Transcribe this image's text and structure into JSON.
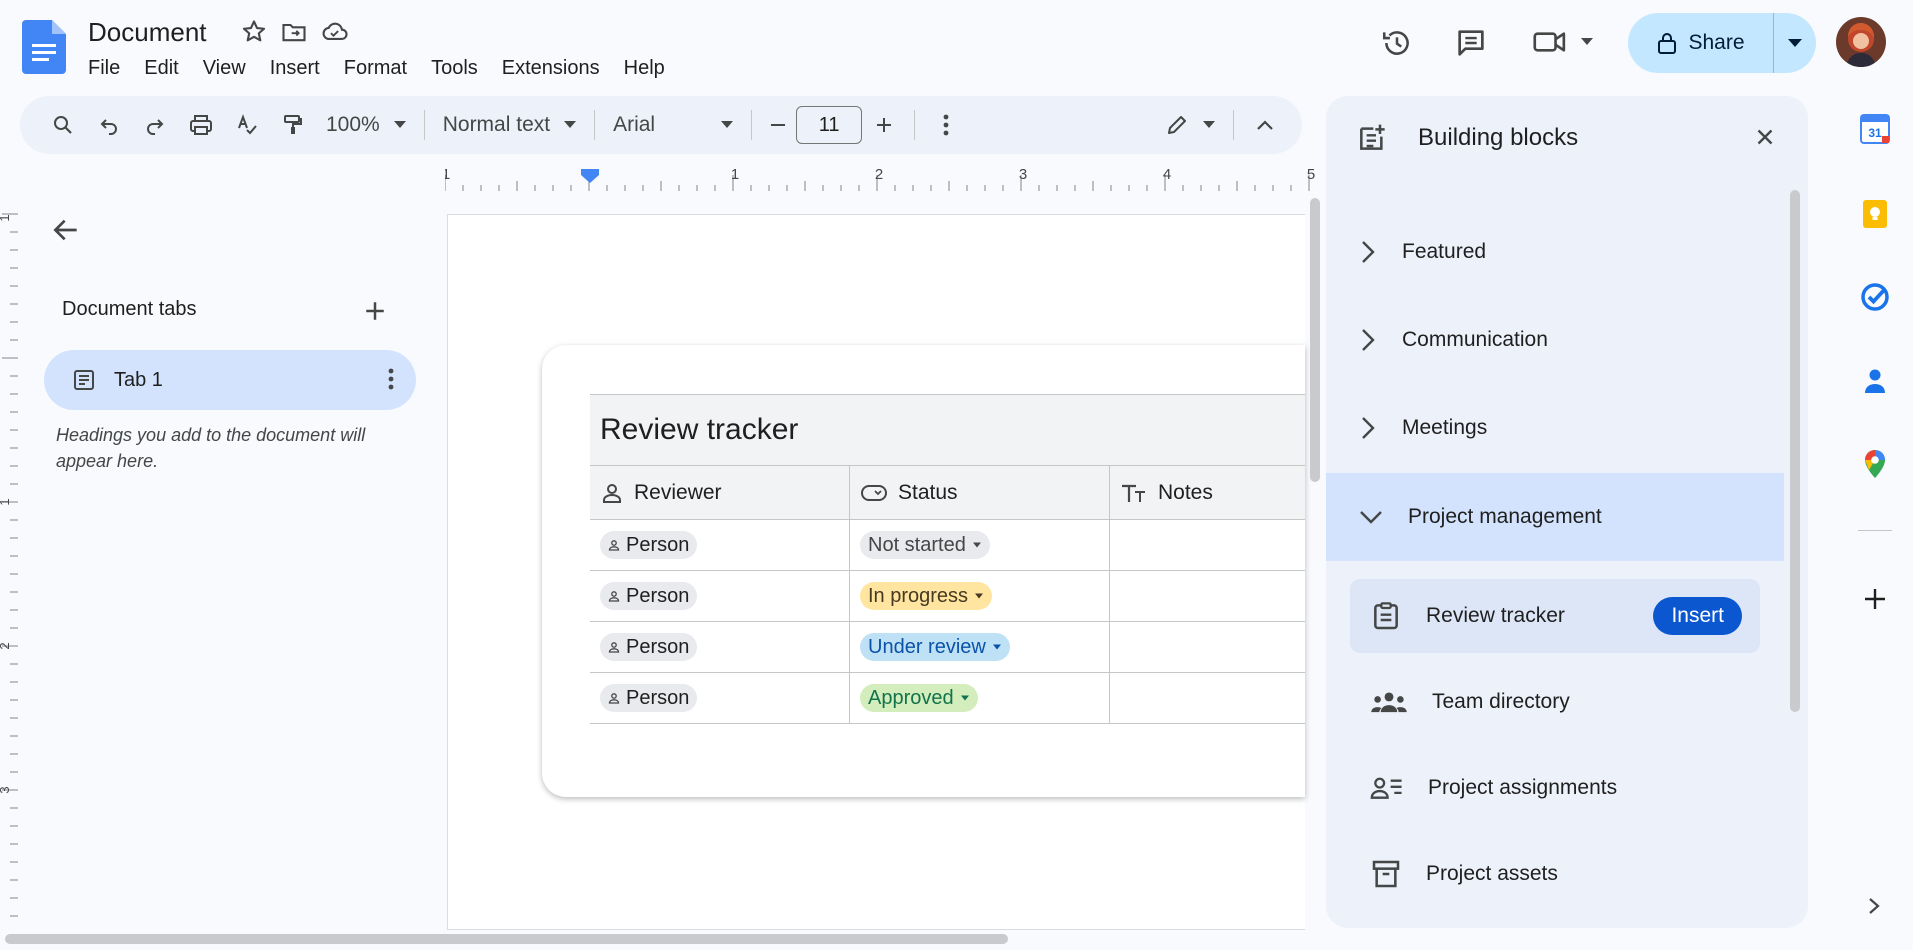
{
  "header": {
    "title": "Document",
    "menu": [
      "File",
      "Edit",
      "View",
      "Insert",
      "Format",
      "Tools",
      "Extensions",
      "Help"
    ],
    "share_label": "Share"
  },
  "toolbar": {
    "zoom": "100%",
    "style": "Normal text",
    "font": "Arial",
    "font_size": "11"
  },
  "ruler": {
    "h_ticks": [
      "1",
      "1",
      "2",
      "3",
      "4",
      "5"
    ],
    "v_ticks": [
      "1",
      "1",
      "2",
      "3"
    ]
  },
  "left_pane": {
    "section_title": "Document tabs",
    "tab_label": "Tab 1",
    "hint": "Headings you add to the document will appear here."
  },
  "table": {
    "title": "Review tracker",
    "headers": [
      "Reviewer",
      "Status",
      "Notes"
    ],
    "rows": [
      {
        "person": "Person",
        "status": "Not started"
      },
      {
        "person": "Person",
        "status": "In progress"
      },
      {
        "person": "Person",
        "status": "Under review"
      },
      {
        "person": "Person",
        "status": "Approved"
      }
    ]
  },
  "panel": {
    "title": "Building blocks",
    "categories": [
      "Featured",
      "Communication",
      "Meetings",
      "Project management"
    ],
    "items": [
      {
        "label": "Review tracker",
        "icon": "clipboard-icon"
      },
      {
        "label": "Team directory",
        "icon": "people-icon"
      },
      {
        "label": "Project assignments",
        "icon": "assignment-list-icon"
      },
      {
        "label": "Project assets",
        "icon": "archive-box-icon"
      }
    ],
    "insert_label": "Insert"
  },
  "rail_calendar_day": "31",
  "colors": {
    "accent": "#0b57d0",
    "share_bg": "#c2e7ff",
    "active_tab": "#d3e3fd",
    "panel_bg": "#edf2fa"
  }
}
